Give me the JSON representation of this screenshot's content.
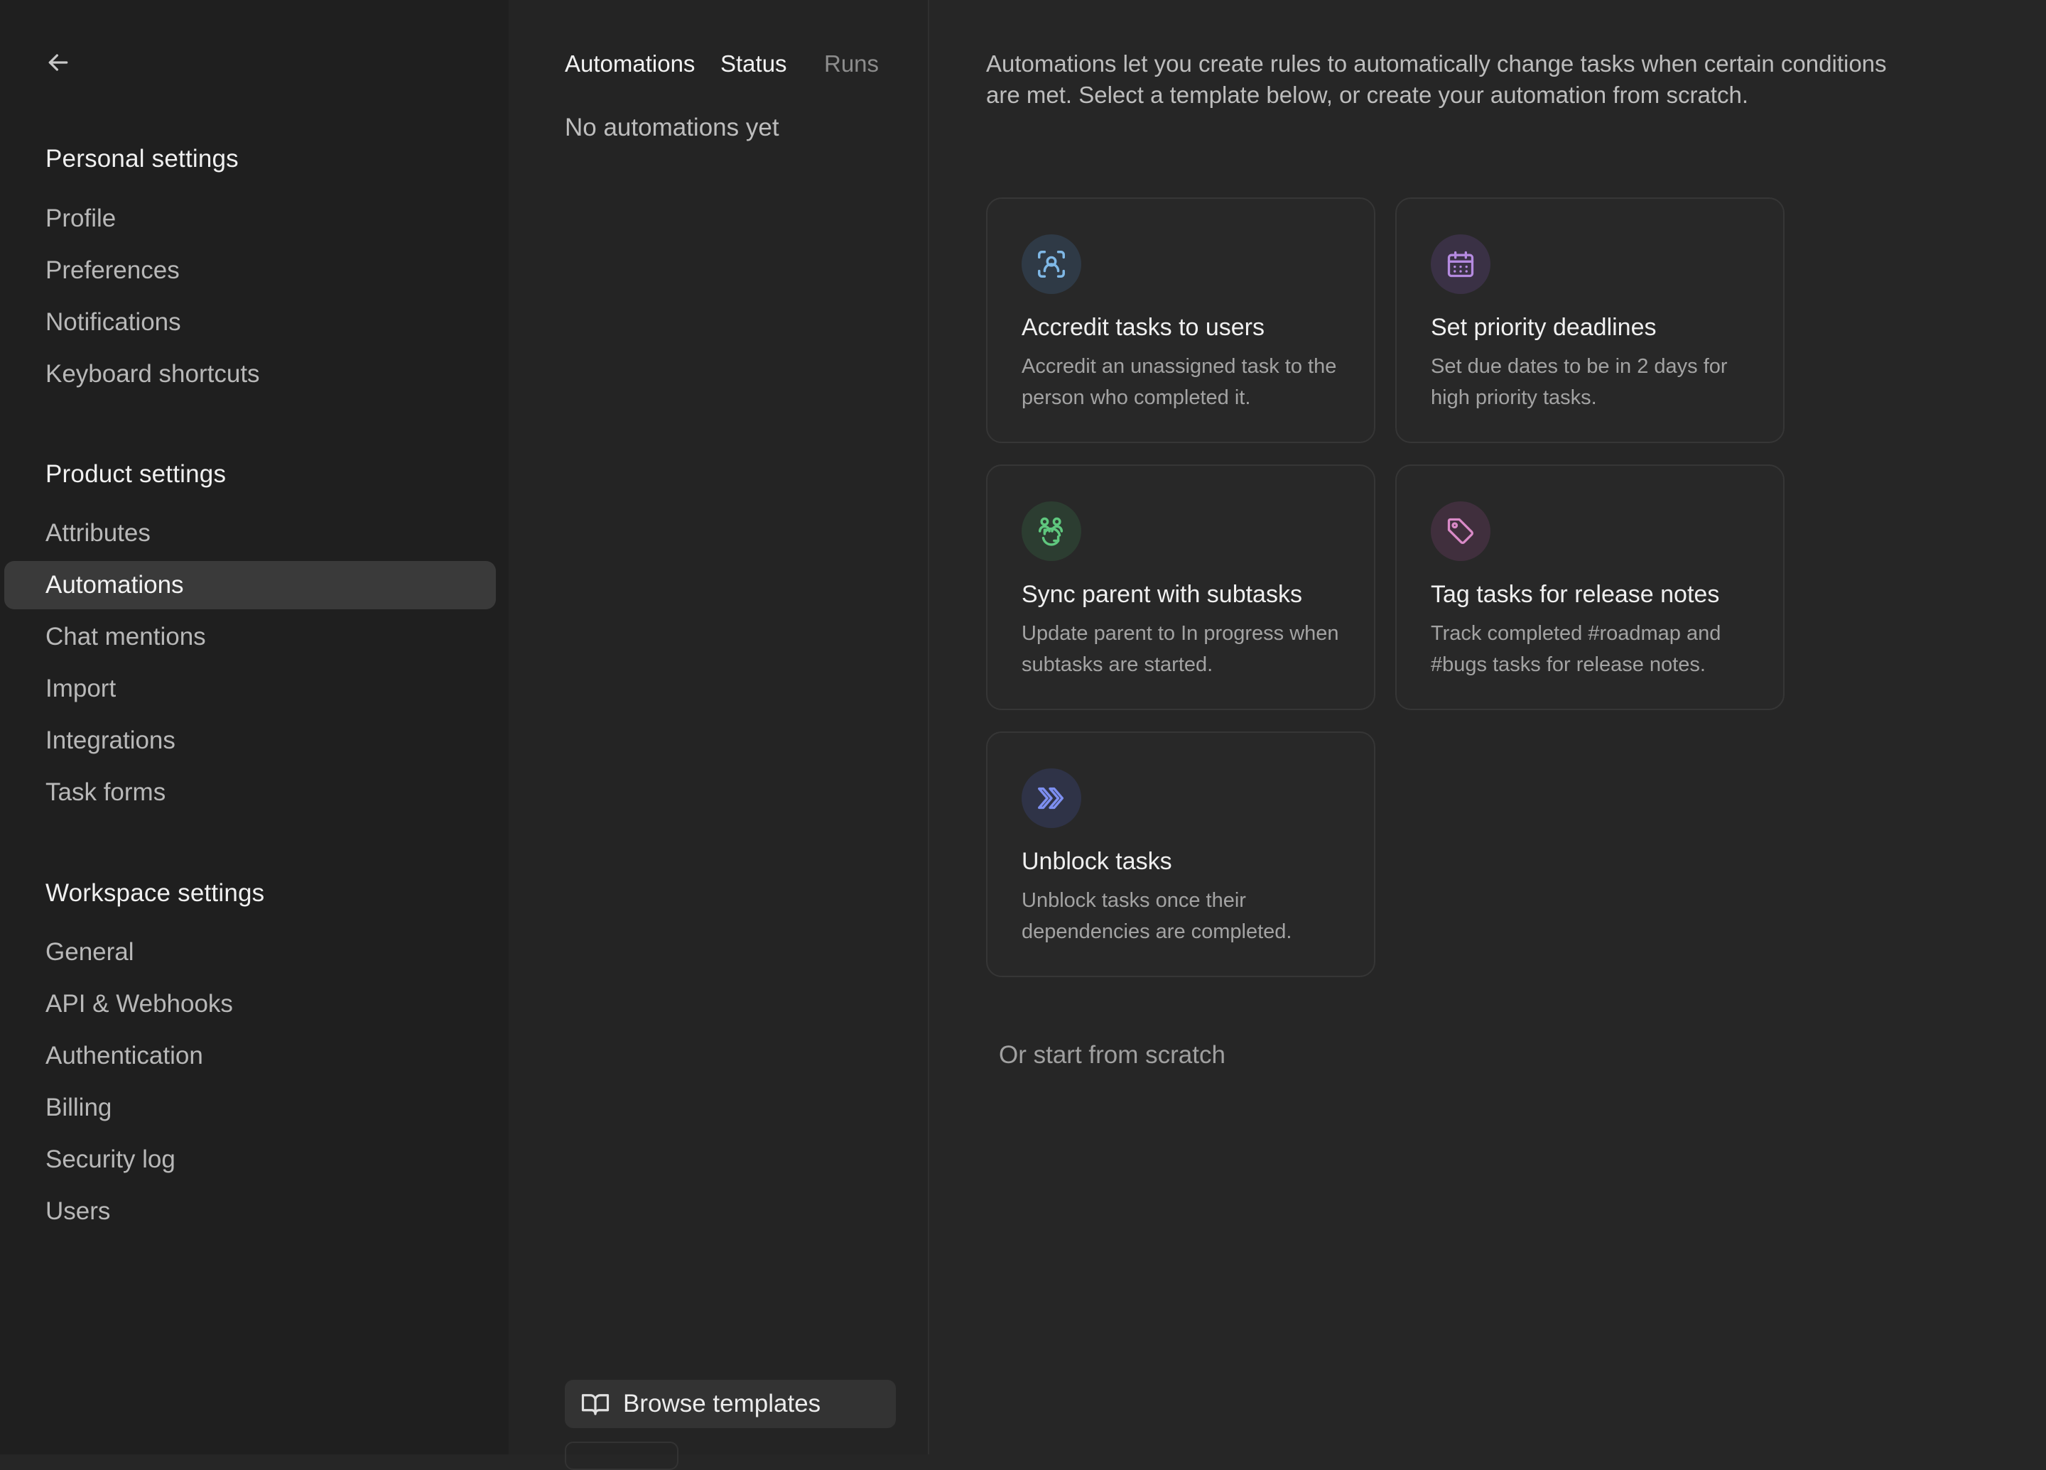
{
  "sidebar": {
    "back_icon": "arrow-left-icon",
    "personal": {
      "title": "Personal settings",
      "items": [
        "Profile",
        "Preferences",
        "Notifications",
        "Keyboard shortcuts"
      ]
    },
    "product": {
      "title": "Product settings",
      "items": [
        "Attributes",
        "Automations",
        "Chat mentions",
        "Import",
        "Integrations",
        "Task forms"
      ],
      "active": "Automations"
    },
    "workspace": {
      "title": "Workspace settings",
      "items": [
        "General",
        "API & Webhooks",
        "Authentication",
        "Billing",
        "Security log",
        "Users"
      ]
    }
  },
  "list": {
    "headers": {
      "automations": "Automations",
      "status": "Status",
      "runs": "Runs"
    },
    "empty": "No automations yet",
    "browse_label": "Browse templates",
    "browse_icon": "book-open-icon"
  },
  "main": {
    "intro": "Automations let you create rules to automatically change tasks when certain conditions are met. Select a template below, or create your automation from scratch.",
    "templates": [
      {
        "title": "Accredit tasks to users",
        "desc": "Accredit an unassigned task to the person who completed it.",
        "icon": "user-scan-icon",
        "color": "#7fb8e6",
        "bg": "#2f3a46"
      },
      {
        "title": "Set priority deadlines",
        "desc": "Set due dates to be in 2 days for high priority tasks.",
        "icon": "calendar-icon",
        "color": "#b58ae0",
        "bg": "#3a3145"
      },
      {
        "title": "Sync parent with subtasks",
        "desc": "Update parent to In progress when subtasks are started.",
        "icon": "users-sync-icon",
        "color": "#5fc77e",
        "bg": "#2c3d31"
      },
      {
        "title": "Tag tasks for release notes",
        "desc": "Track completed #roadmap and #bugs tasks for release notes.",
        "icon": "tag-icon",
        "color": "#d98ac7",
        "bg": "#402f3d"
      },
      {
        "title": "Unblock tasks",
        "desc": "Unblock tasks once their dependencies are completed.",
        "icon": "double-chevron-right-icon",
        "color": "#7d8ff0",
        "bg": "#2f3347"
      }
    ],
    "scratch_label": "Or start from scratch"
  }
}
